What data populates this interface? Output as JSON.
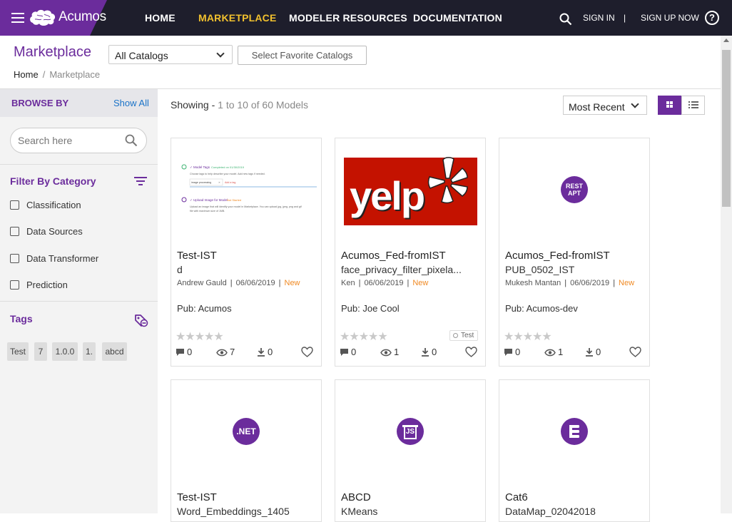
{
  "brand": {
    "name": "Acumos"
  },
  "nav": {
    "items": [
      "HOME",
      "MARKETPLACE",
      "MODELER RESOURCES",
      "DOCUMENTATION"
    ],
    "active": "MARKETPLACE",
    "sign_in": "SIGN IN",
    "separator": "|",
    "sign_up": "SIGN UP NOW",
    "help": "?"
  },
  "header": {
    "title": "Marketplace",
    "catalog_select": "All Catalogs",
    "favorite_button": "Select Favorite Catalogs",
    "breadcrumb": [
      "Home",
      "/",
      "Marketplace"
    ]
  },
  "sidebar": {
    "browse_by": "BROWSE BY",
    "show_all": "Show All",
    "search_placeholder": "Search here",
    "filter_title": "Filter By Category",
    "categories": [
      "Classification",
      "Data Sources",
      "Data Transformer",
      "Prediction"
    ],
    "tags_title": "Tags",
    "tags": [
      "Test",
      "7",
      "1.0.0",
      "1.",
      "abcd"
    ]
  },
  "main": {
    "showing_label": "Showing -",
    "showing_range": "1 to 10 of 60 Models",
    "sort": "Most Recent",
    "cards": [
      {
        "title": "Test-IST",
        "subtitle": "d",
        "author": "Andrew Gauld",
        "date": "06/06/2019",
        "badge": "New",
        "pub": "Pub: Acumos",
        "comments": "0",
        "views": "7",
        "downloads": "0",
        "thumb": "screenshot",
        "tag": ""
      },
      {
        "title": "Acumos_Fed-fromIST",
        "subtitle": "face_privacy_filter_pixela...",
        "author": "Ken",
        "date": "06/06/2019",
        "badge": "New",
        "pub": "Pub: Joe Cool",
        "comments": "0",
        "views": "1",
        "downloads": "0",
        "thumb": "yelp",
        "tag": "Test"
      },
      {
        "title": "Acumos_Fed-fromIST",
        "subtitle": "PUB_0502_IST",
        "author": "Mukesh Mantan",
        "date": "06/06/2019",
        "badge": "New",
        "pub": "Pub: Acumos-dev",
        "comments": "0",
        "views": "1",
        "downloads": "0",
        "thumb": "rest-api",
        "tag": ""
      },
      {
        "title": "Test-IST",
        "subtitle": "Word_Embeddings_1405",
        "thumb": "dotnet"
      },
      {
        "title": "ABCD",
        "subtitle": "KMeans",
        "thumb": "js"
      },
      {
        "title": "Cat6",
        "subtitle": "DataMap_02042018",
        "thumb": "stack"
      }
    ],
    "thumb_texts": {
      "yelp": "yelp",
      "rest": "REST",
      "apt": "APT",
      "dotnet": ".NET",
      "js": "JS",
      "shot_line1": "✓ Model Tags",
      "shot_line1b": "Completed on 01/30/2019",
      "shot_line2": "Choose tags to help describe your model. Add new tags if needed.",
      "shot_chip": "image processing",
      "shot_chip_x": "✕",
      "shot_add": "Add a tag",
      "shot_line3": "✓ Upload Image for Model",
      "shot_line3b": "Not Started",
      "shot_line4": "Upload an image that will identify your model in Marketplace. You can upload jpg, jpeg, png and gif",
      "shot_line5": "file with maximum size of 1MB."
    }
  },
  "colors": {
    "brand_purple": "#6b2c9c",
    "nav_bg": "#1e1e2c",
    "active_nav": "#f2c12e",
    "new_badge": "#f08a24",
    "yelp_red": "#c41200"
  }
}
